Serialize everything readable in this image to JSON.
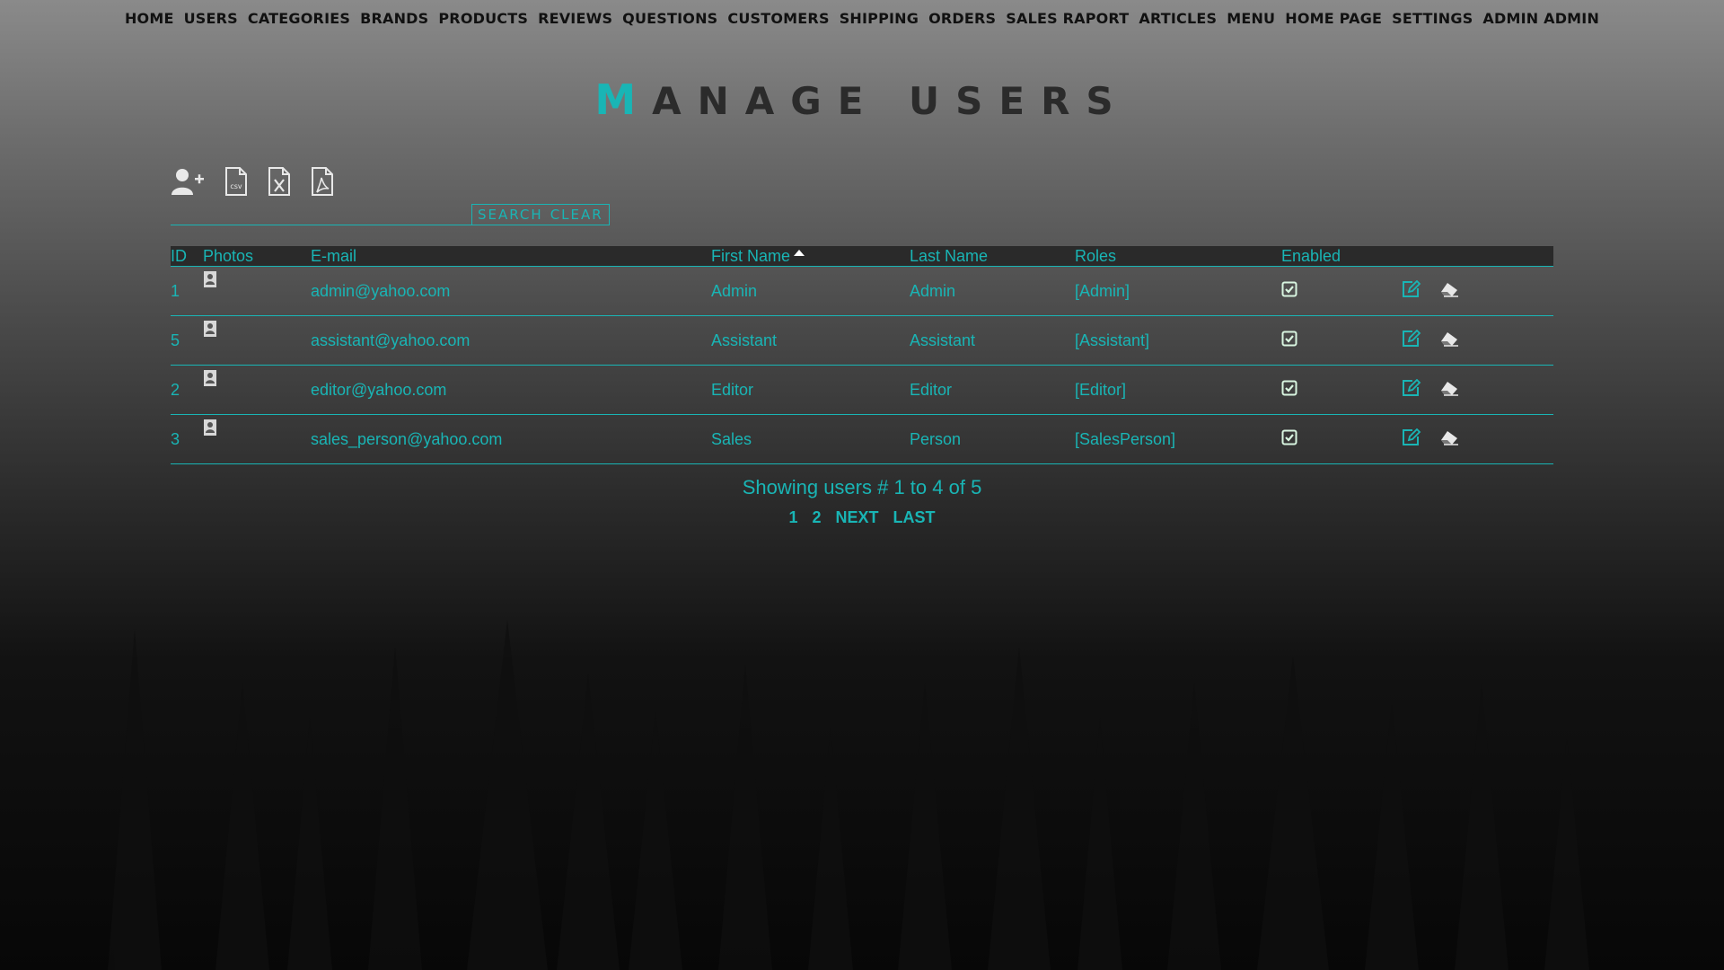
{
  "nav": {
    "items": [
      "HOME",
      "USERS",
      "CATEGORIES",
      "BRANDS",
      "PRODUCTS",
      "REVIEWS",
      "QUESTIONS",
      "CUSTOMERS",
      "SHIPPING",
      "ORDERS",
      "SALES RAPORT",
      "ARTICLES",
      "MENU",
      "HOME PAGE",
      "SETTINGS",
      "ADMIN ADMIN"
    ]
  },
  "title": {
    "first_letter": "M",
    "rest": "ANAGE USERS"
  },
  "toolbar": {
    "icons": [
      "add-user-icon",
      "csv-export-icon",
      "excel-export-icon",
      "pdf-export-icon"
    ]
  },
  "search": {
    "value": "",
    "search_label": "SEARCH",
    "clear_label": "CLEAR"
  },
  "table": {
    "columns": [
      "ID",
      "Photos",
      "E-mail",
      "First Name",
      "Last Name",
      "Roles",
      "Enabled"
    ],
    "sorted_column": "First Name",
    "sort_direction": "asc",
    "rows": [
      {
        "id": "1",
        "email": "admin@yahoo.com",
        "first_name": "Admin",
        "last_name": "Admin",
        "roles": "[Admin]",
        "enabled": true
      },
      {
        "id": "5",
        "email": "assistant@yahoo.com",
        "first_name": "Assistant",
        "last_name": "Assistant",
        "roles": "[Assistant]",
        "enabled": true
      },
      {
        "id": "2",
        "email": "editor@yahoo.com",
        "first_name": "Editor",
        "last_name": "Editor",
        "roles": "[Editor]",
        "enabled": true
      },
      {
        "id": "3",
        "email": "sales_person@yahoo.com",
        "first_name": "Sales",
        "last_name": "Person",
        "roles": "[SalesPerson]",
        "enabled": true
      }
    ]
  },
  "pager": {
    "info": "Showing users # 1 to 4 of 5",
    "links": [
      "1",
      "2",
      "NEXT",
      "LAST"
    ]
  },
  "colors": {
    "accent": "#19b5b5",
    "text_dark": "#111111"
  }
}
